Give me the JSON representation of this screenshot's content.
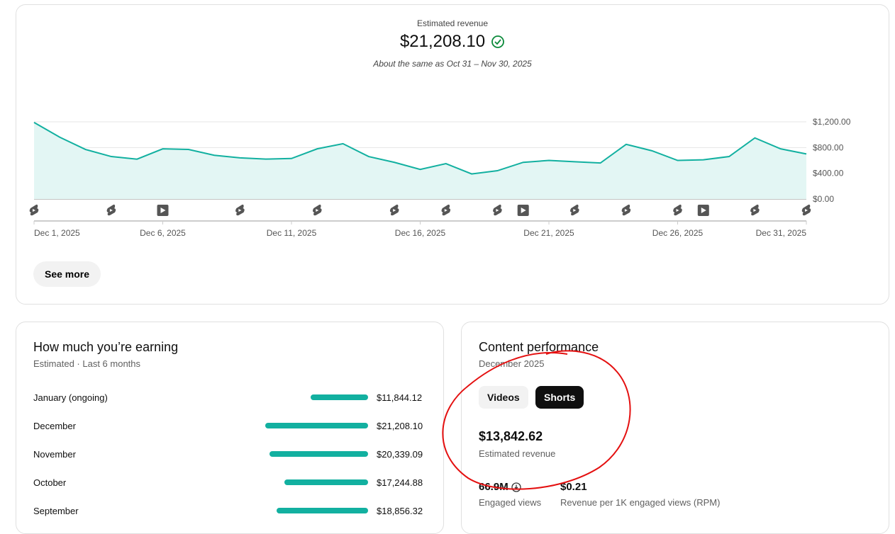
{
  "summary": {
    "label": "Estimated revenue",
    "value": "$21,208.10",
    "comparison": "About the same as Oct 31 – Nov 30, 2025",
    "see_more": "See more"
  },
  "chart_data": {
    "type": "area",
    "title": "Estimated revenue",
    "x_labels": [
      "Dec 1, 2025",
      "Dec 6, 2025",
      "Dec 11, 2025",
      "Dec 16, 2025",
      "Dec 21, 2025",
      "Dec 26, 2025",
      "Dec 31, 2025"
    ],
    "y_ticks": [
      "$0.00",
      "$400.00",
      "$800.00",
      "$1,200.00"
    ],
    "ylim": [
      0,
      1200
    ],
    "days": [
      1,
      2,
      3,
      4,
      5,
      6,
      7,
      8,
      9,
      10,
      11,
      12,
      13,
      14,
      15,
      16,
      17,
      18,
      19,
      20,
      21,
      22,
      23,
      24,
      25,
      26,
      27,
      28,
      29,
      30,
      31
    ],
    "values": [
      1190,
      960,
      770,
      660,
      620,
      780,
      770,
      680,
      640,
      620,
      630,
      780,
      860,
      660,
      570,
      460,
      550,
      390,
      440,
      570,
      600,
      580,
      560,
      850,
      750,
      600,
      610,
      660,
      950,
      780,
      700
    ],
    "line_color": "#12b0a0",
    "fill_color": "#e3f6f4",
    "markers": [
      {
        "day": 1,
        "type": "short"
      },
      {
        "day": 4,
        "type": "short"
      },
      {
        "day": 6,
        "type": "video"
      },
      {
        "day": 9,
        "type": "short"
      },
      {
        "day": 12,
        "type": "short"
      },
      {
        "day": 15,
        "type": "short"
      },
      {
        "day": 17,
        "type": "short"
      },
      {
        "day": 19,
        "type": "short"
      },
      {
        "day": 20,
        "type": "video"
      },
      {
        "day": 22,
        "type": "short"
      },
      {
        "day": 24,
        "type": "short"
      },
      {
        "day": 26,
        "type": "short"
      },
      {
        "day": 27,
        "type": "video"
      },
      {
        "day": 29,
        "type": "short"
      },
      {
        "day": 31,
        "type": "short"
      }
    ]
  },
  "earning": {
    "title": "How much you’re earning",
    "subtitle": "Estimated · Last 6 months",
    "rows": [
      {
        "month": "January (ongoing)",
        "value": "$11,844.12",
        "amount": 11844.12
      },
      {
        "month": "December",
        "value": "$21,208.10",
        "amount": 21208.1
      },
      {
        "month": "November",
        "value": "$20,339.09",
        "amount": 20339.09
      },
      {
        "month": "October",
        "value": "$17,244.88",
        "amount": 17244.88
      },
      {
        "month": "September",
        "value": "$18,856.32",
        "amount": 18856.32
      }
    ]
  },
  "performance": {
    "title": "Content performance",
    "subtitle": "December 2025",
    "tabs": [
      "Videos",
      "Shorts"
    ],
    "active_tab": "Shorts",
    "revenue": "$13,842.62",
    "revenue_label": "Estimated revenue",
    "metrics": [
      {
        "value": "66.9M",
        "label": "Engaged views"
      },
      {
        "value": "$0.21",
        "label": "Revenue per 1K engaged views (RPM)"
      }
    ]
  }
}
